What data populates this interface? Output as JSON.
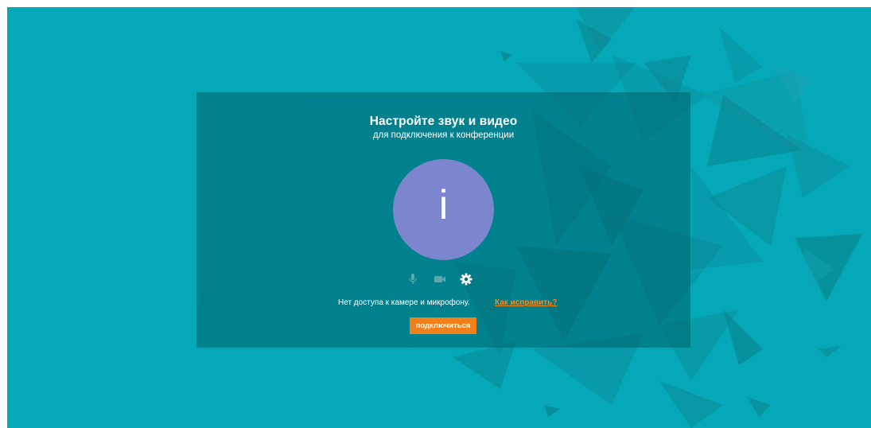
{
  "setup": {
    "title": "Настройте звук и видео",
    "subtitle": "для подключения к конференции",
    "avatar_letter": "i",
    "status_text": "Нет доступа к камере и микрофону.",
    "fix_link": "Как исправить?",
    "connect_button": "подключиться"
  },
  "colors": {
    "background": "#05a8b7",
    "panel": "#006973",
    "avatar": "#7b86cf",
    "accent": "#f2801b"
  },
  "icons": {
    "microphone": "microphone-icon",
    "camera": "camera-icon",
    "settings": "gear-icon"
  }
}
